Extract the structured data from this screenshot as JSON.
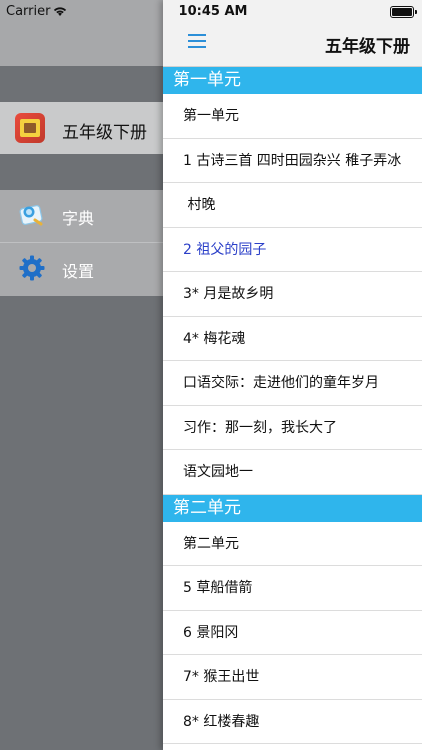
{
  "status": {
    "carrier": "Carrier",
    "time": "10:45 AM"
  },
  "left_menu": {
    "book": "五年级下册",
    "items": [
      {
        "label": "字典",
        "icon": "dictionary-icon"
      },
      {
        "label": "设置",
        "icon": "gear-icon"
      }
    ]
  },
  "header": {
    "title": "五年级下册"
  },
  "sections": [
    {
      "title": "第一单元",
      "rows": [
        "第一单元",
        "1 古诗三首  四时田园杂兴  稚子弄冰",
        " 村晚",
        "2 祖父的园子",
        "3* 月是故乡明",
        "4* 梅花魂",
        "口语交际：走进他们的童年岁月",
        "习作：那一刻，我长大了",
        "语文园地一"
      ]
    },
    {
      "title": "第二单元",
      "rows": [
        "第二单元",
        "5 草船借箭",
        "6 景阳冈",
        "7* 猴王出世",
        "8* 红楼春趣"
      ]
    }
  ],
  "colors": {
    "accent": "#2fb5ec",
    "active_text": "#2b3fc8",
    "nav_icon": "#2c8fd8"
  }
}
